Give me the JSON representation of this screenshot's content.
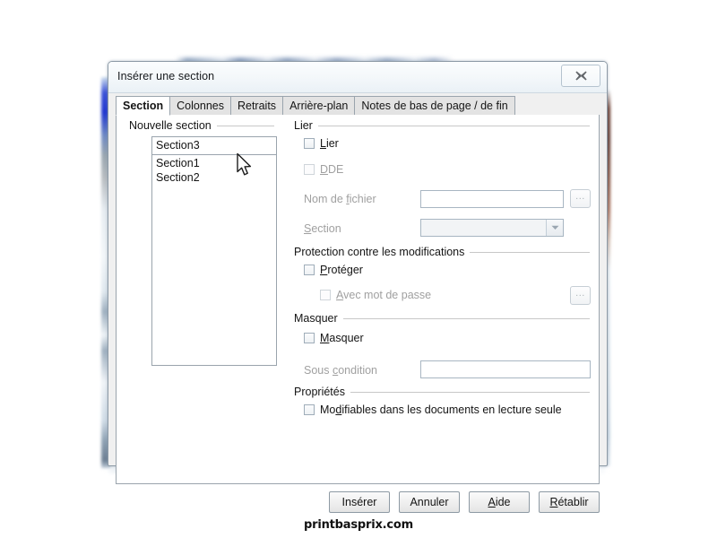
{
  "background": {
    "page_color": "#ffffff",
    "blurred_window_title_present": true
  },
  "dialog": {
    "title": "Insérer une section",
    "close_icon": "close-x-icon",
    "tabs": [
      {
        "label": "Section",
        "active": true
      },
      {
        "label": "Colonnes",
        "active": false
      },
      {
        "label": "Retraits",
        "active": false
      },
      {
        "label": "Arrière-plan",
        "active": false
      },
      {
        "label": "Notes de bas de page / de fin",
        "active": false
      }
    ]
  },
  "new_section": {
    "group_label": "Nouvelle section",
    "name_value": "Section3",
    "list_items": [
      "Section1",
      "Section2"
    ]
  },
  "link": {
    "group_label": "Lier",
    "lier_checkbox": {
      "label": "Lier",
      "checked": false,
      "enabled": true
    },
    "dde_checkbox": {
      "label": "DDE",
      "checked": false,
      "enabled": false
    },
    "filename_label": "Nom de fichier",
    "filename_value": "",
    "filename_browse_label": "...",
    "section_label": "Section",
    "section_value": "",
    "section_dropdown_icon": "chevron-down-icon"
  },
  "protection": {
    "group_label": "Protection contre les modifications",
    "protect_checkbox": {
      "label": "Protéger",
      "checked": false,
      "enabled": true
    },
    "password_checkbox": {
      "label": "Avec mot de passe",
      "checked": false,
      "enabled": false
    },
    "password_browse_label": "..."
  },
  "hide": {
    "group_label": "Masquer",
    "hide_checkbox": {
      "label": "Masquer",
      "checked": false,
      "enabled": true
    },
    "condition_label": "Sous condition",
    "condition_value": ""
  },
  "properties": {
    "group_label": "Propriétés",
    "editable_checkbox": {
      "label": "Modifiables dans les documents en lecture seule",
      "checked": false,
      "enabled": true
    }
  },
  "footer": {
    "insert_label": "Insérer",
    "cancel_label": "Annuler",
    "help_label": "Aide",
    "reset_label": "Rétablir"
  },
  "watermark": {
    "text": "printbasprix.com"
  },
  "colors": {
    "dialog_bg": "#f0f0f0",
    "panel_bg": "#ffffff",
    "border": "#9aa4ad",
    "disabled_text": "#a0a0a0",
    "text": "#141414"
  }
}
